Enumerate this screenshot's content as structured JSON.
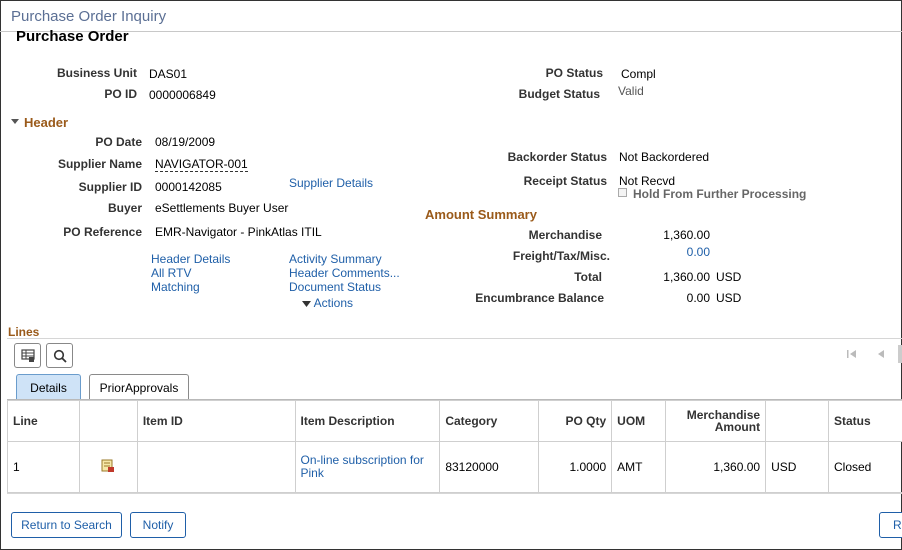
{
  "page_title": "Purchase Order Inquiry",
  "sub_title": "Purchase Order",
  "top": {
    "business_unit_label": "Business Unit",
    "business_unit": "DAS01",
    "po_id_label": "PO ID",
    "po_id": "0000006849",
    "po_status_label": "PO Status",
    "po_status": "Compl",
    "budget_status_label": "Budget Status",
    "budget_status": "Valid"
  },
  "header": {
    "title": "Header",
    "po_date_label": "PO Date",
    "po_date": "08/19/2009",
    "supplier_name_label": "Supplier Name",
    "supplier_name": "NAVIGATOR-001",
    "supplier_id_label": "Supplier ID",
    "supplier_id": "0000142085",
    "supplier_details": "Supplier Details",
    "buyer_label": "Buyer",
    "buyer": "eSettlements Buyer User",
    "po_reference_label": "PO Reference",
    "po_reference": "EMR-Navigator - PinkAtlas ITIL",
    "backorder_status_label": "Backorder Status",
    "backorder_status": "Not Backordered",
    "receipt_status_label": "Receipt Status",
    "receipt_status": "Not Recvd",
    "hold_label": "Hold From Further Processing",
    "links_left": [
      "Header Details",
      "All RTV",
      "Matching"
    ],
    "links_right": [
      "Activity Summary",
      "Header Comments...",
      "Document Status"
    ],
    "actions": "Actions"
  },
  "amount_summary": {
    "title": "Amount Summary",
    "merchandise_label": "Merchandise",
    "merchandise": "1,360.00",
    "freight_label": "Freight/Tax/Misc.",
    "freight": "0.00",
    "total_label": "Total",
    "total": "1,360.00",
    "total_currency": "USD",
    "encumbrance_label": "Encumbrance Balance",
    "encumbrance": "0.00",
    "encumbrance_currency": "USD"
  },
  "lines": {
    "title": "Lines",
    "tabs": [
      "Details",
      "PriorApprovals"
    ],
    "columns": [
      "Line",
      "",
      "Item ID",
      "Item Description",
      "Category",
      "PO Qty",
      "UOM",
      "Merchandise Amount",
      "",
      "Status"
    ],
    "rows": [
      {
        "line": "1",
        "item_id": "",
        "description": "On-line subscription for Pink",
        "category": "83120000",
        "po_qty": "1.0000",
        "uom": "AMT",
        "merchandise": "1,360.00",
        "currency": "USD",
        "status": "Closed"
      }
    ]
  },
  "buttons": {
    "return_to_search": "Return to Search",
    "notify": "Notify",
    "partial": "R"
  }
}
